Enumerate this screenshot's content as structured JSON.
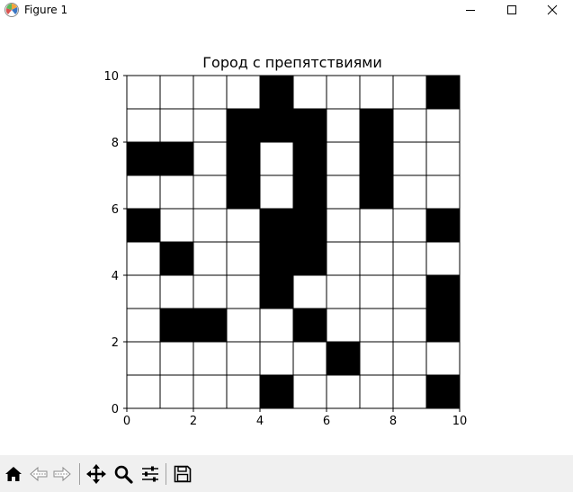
{
  "window": {
    "title": "Figure 1"
  },
  "chart_data": {
    "type": "heatmap",
    "title": "Город с препятствиями",
    "xlabel": "",
    "ylabel": "",
    "xlim": [
      0,
      10
    ],
    "ylim": [
      0,
      10
    ],
    "xticks": [
      "0",
      "2",
      "4",
      "6",
      "8",
      "10"
    ],
    "yticks": [
      "0",
      "2",
      "4",
      "6",
      "8",
      "10"
    ],
    "colors": {
      "obstacle": "#000000",
      "free": "#ffffff",
      "grid": "#000000"
    },
    "grid_rows_top_to_bottom": [
      [
        0,
        0,
        0,
        0,
        1,
        0,
        0,
        0,
        0,
        1
      ],
      [
        0,
        0,
        0,
        1,
        1,
        1,
        0,
        1,
        0,
        0
      ],
      [
        1,
        1,
        0,
        1,
        0,
        1,
        0,
        1,
        0,
        0
      ],
      [
        0,
        0,
        0,
        1,
        0,
        1,
        0,
        1,
        0,
        0
      ],
      [
        1,
        0,
        0,
        0,
        1,
        1,
        0,
        0,
        0,
        1
      ],
      [
        0,
        1,
        0,
        0,
        1,
        1,
        0,
        0,
        0,
        0
      ],
      [
        0,
        0,
        0,
        0,
        1,
        0,
        0,
        0,
        0,
        1
      ],
      [
        0,
        1,
        1,
        0,
        0,
        1,
        0,
        0,
        0,
        1
      ],
      [
        0,
        0,
        0,
        0,
        0,
        0,
        1,
        0,
        0,
        0
      ],
      [
        0,
        0,
        0,
        0,
        1,
        0,
        0,
        0,
        0,
        1
      ]
    ]
  },
  "toolbar": {
    "buttons": [
      {
        "icon": "home-icon",
        "label": "Home"
      },
      {
        "icon": "back-arrow-icon",
        "label": "Back"
      },
      {
        "icon": "forward-arrow-icon",
        "label": "Forward"
      },
      {
        "icon": "pan-icon",
        "label": "Pan"
      },
      {
        "icon": "zoom-icon",
        "label": "Zoom"
      },
      {
        "icon": "subplots-config-icon",
        "label": "Configure subplots"
      },
      {
        "icon": "save-icon",
        "label": "Save"
      }
    ]
  }
}
